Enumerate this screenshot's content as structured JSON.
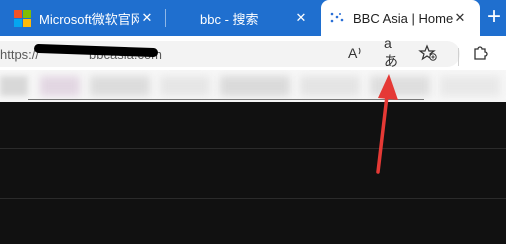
{
  "tabs": [
    {
      "label": "Microsoft微软官网",
      "active": false
    },
    {
      "label": "bbc - 搜索",
      "active": false
    },
    {
      "label": "BBC Asia | Home",
      "active": true
    }
  ],
  "tab_close_glyph": "✕",
  "new_tab_glyph": "+",
  "address_bar": {
    "url_visible_prefix": "https://",
    "url_visible_suffix": "bbcasia.com",
    "url_middle_redacted": true
  },
  "toolbar_icons": [
    "read-aloud-icon",
    "translate-icon",
    "add-favorite-icon",
    "extensions-icon"
  ],
  "toolbar_icon_glyphs": {
    "read_aloud": "A",
    "translate": "aあ"
  },
  "favorites_bar": {
    "blurred": true
  },
  "colors": {
    "tab_strip": "#1f6fcf",
    "active_tab": "#ffffff",
    "toolbar": "#ffffff",
    "page_background": "#111111",
    "annotation_arrow": "#e53935"
  },
  "annotation": {
    "type": "arrow",
    "points_to": "translate-icon"
  }
}
